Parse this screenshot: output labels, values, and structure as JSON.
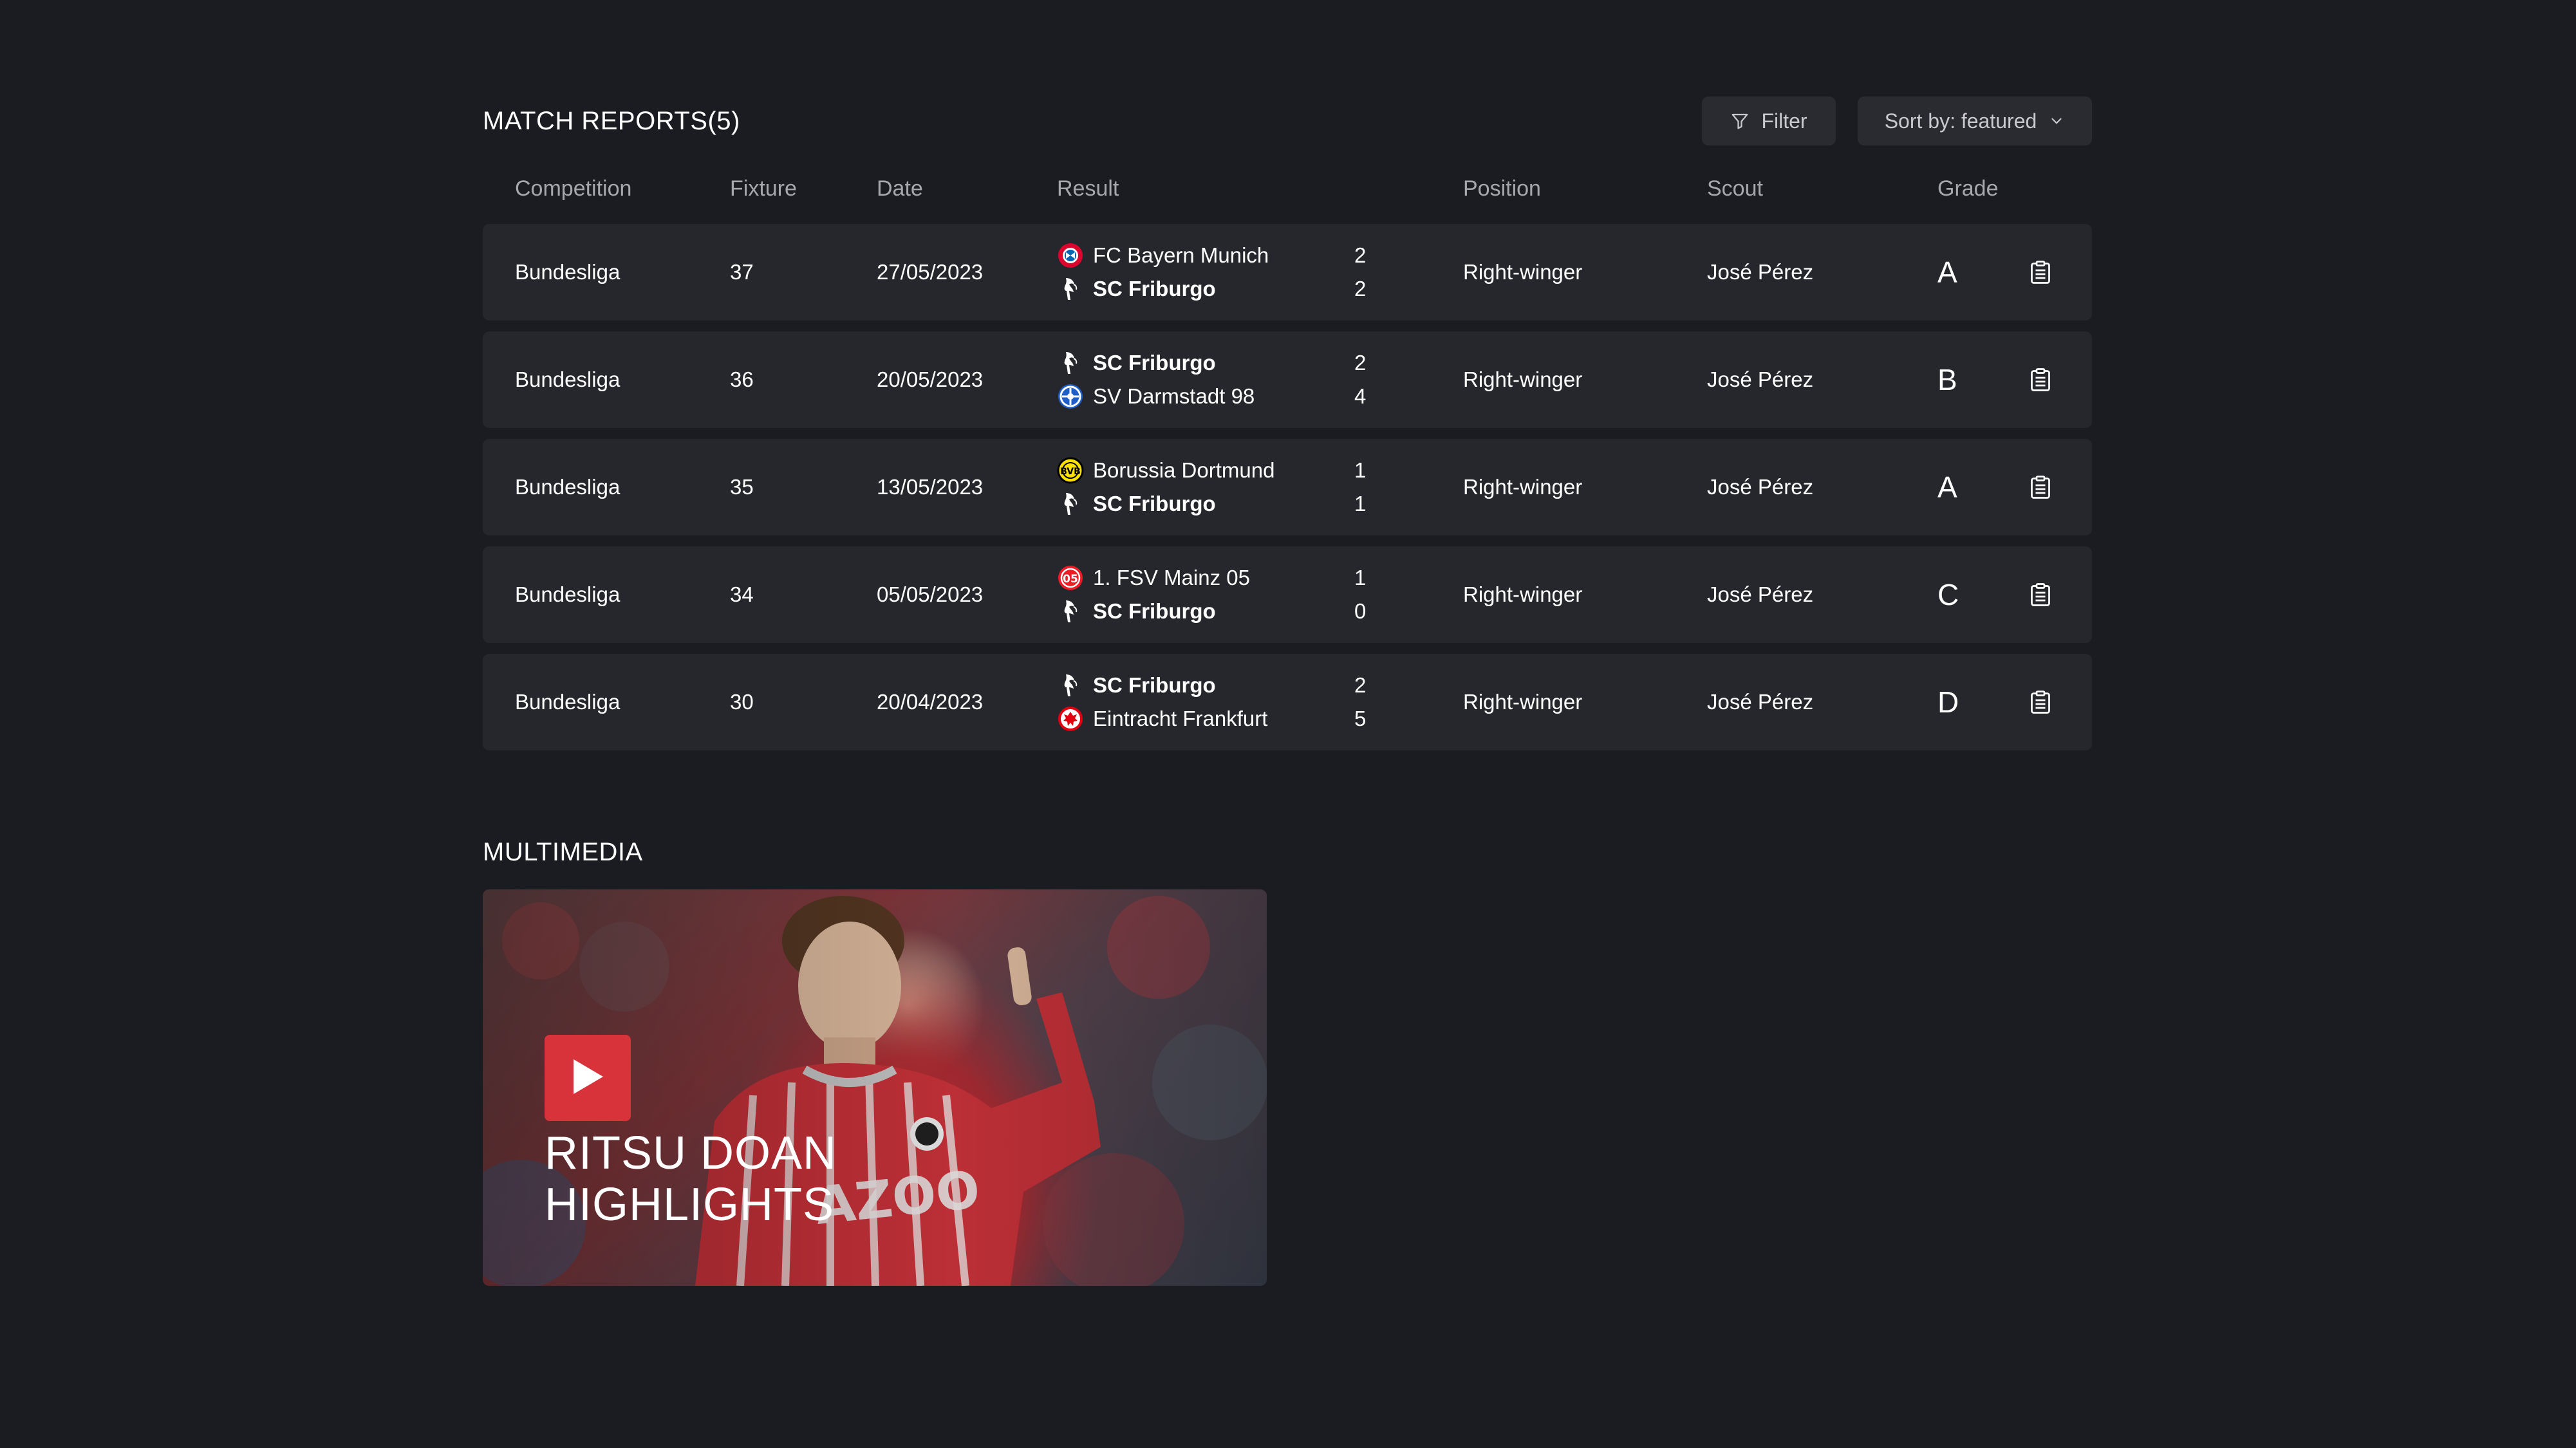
{
  "reports": {
    "title": "MATCH REPORTS(5)",
    "filter_label": "Filter",
    "sort_label": "Sort by: featured",
    "columns": {
      "competition": "Competition",
      "fixture": "Fixture",
      "date": "Date",
      "result": "Result",
      "position": "Position",
      "scout": "Scout",
      "grade": "Grade"
    },
    "rows": [
      {
        "competition": "Bundesliga",
        "fixture": "37",
        "date": "27/05/2023",
        "home": {
          "name": "FC Bayern Munich",
          "crest": "bayern-crest",
          "score": "2"
        },
        "away": {
          "name": "SC Friburgo",
          "crest": "freiburg-crest",
          "score": "2"
        },
        "position": "Right-winger",
        "scout": "José Pérez",
        "grade": "A"
      },
      {
        "competition": "Bundesliga",
        "fixture": "36",
        "date": "20/05/2023",
        "home": {
          "name": "SC Friburgo",
          "crest": "freiburg-crest",
          "score": "2"
        },
        "away": {
          "name": "SV Darmstadt 98",
          "crest": "darmstadt-crest",
          "score": "4"
        },
        "position": "Right-winger",
        "scout": "José Pérez",
        "grade": "B"
      },
      {
        "competition": "Bundesliga",
        "fixture": "35",
        "date": "13/05/2023",
        "home": {
          "name": "Borussia Dortmund",
          "crest": "dortmund-crest",
          "score": "1"
        },
        "away": {
          "name": "SC Friburgo",
          "crest": "freiburg-crest",
          "score": "1"
        },
        "position": "Right-winger",
        "scout": "José Pérez",
        "grade": "A"
      },
      {
        "competition": "Bundesliga",
        "fixture": "34",
        "date": "05/05/2023",
        "home": {
          "name": "1. FSV Mainz 05",
          "crest": "mainz-crest",
          "score": "1"
        },
        "away": {
          "name": "SC Friburgo",
          "crest": "freiburg-crest",
          "score": "0"
        },
        "position": "Right-winger",
        "scout": "José Pérez",
        "grade": "C"
      },
      {
        "competition": "Bundesliga",
        "fixture": "30",
        "date": "20/04/2023",
        "home": {
          "name": "SC Friburgo",
          "crest": "freiburg-crest",
          "score": "2"
        },
        "away": {
          "name": "Eintracht Frankfurt",
          "crest": "frankfurt-crest",
          "score": "5"
        },
        "position": "Right-winger",
        "scout": "José Pérez",
        "grade": "D"
      }
    ]
  },
  "multimedia": {
    "title": "MULTIMEDIA",
    "video": {
      "title_line1": "RITSU DOAN",
      "title_line2": "HIGHLIGHTS",
      "play_icon": "play-icon"
    }
  },
  "colors": {
    "background": "#1b1c21",
    "row_bg": "#26272d",
    "button_bg": "#2a2b31",
    "accent_red": "#d8323b",
    "muted_text": "#a7a8ae"
  }
}
